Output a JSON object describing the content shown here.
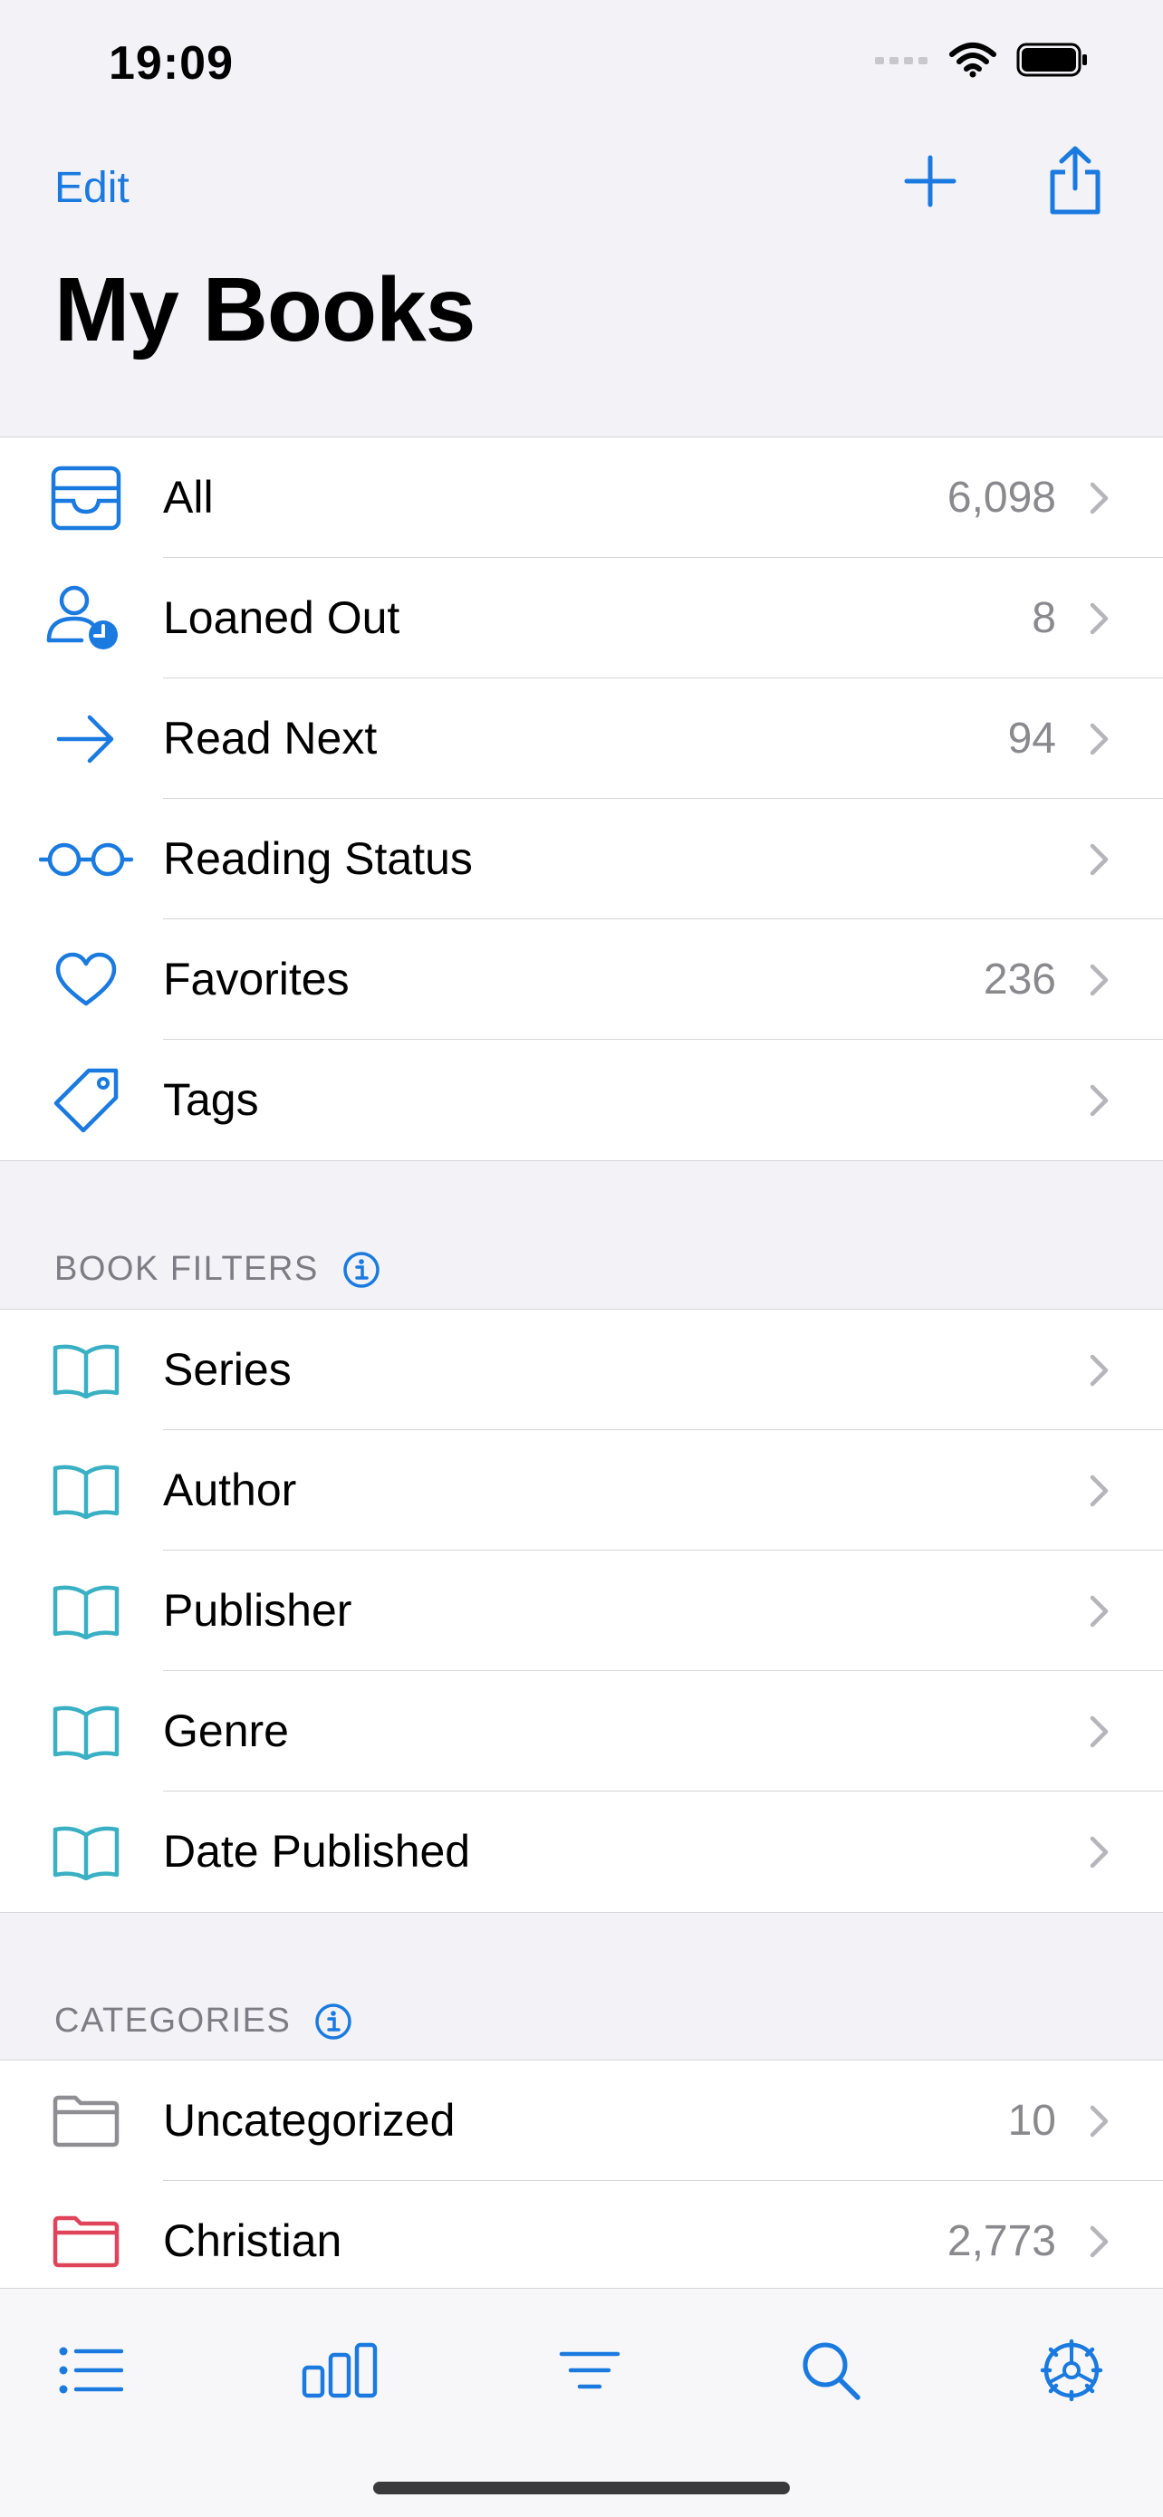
{
  "status": {
    "time": "19:09"
  },
  "nav": {
    "edit_label": "Edit",
    "title": "My Books"
  },
  "library": [
    {
      "icon": "tray-icon",
      "label": "All",
      "count": "6,098"
    },
    {
      "icon": "person-clock-icon",
      "label": "Loaned Out",
      "count": "8"
    },
    {
      "icon": "arrow-right-icon",
      "label": "Read Next",
      "count": "94"
    },
    {
      "icon": "glasses-icon",
      "label": "Reading Status",
      "count": ""
    },
    {
      "icon": "heart-icon",
      "label": "Favorites",
      "count": "236"
    },
    {
      "icon": "tag-icon",
      "label": "Tags",
      "count": ""
    }
  ],
  "book_filters": {
    "header": "BOOK FILTERS",
    "items": [
      {
        "icon": "book-icon",
        "label": "Series"
      },
      {
        "icon": "book-icon",
        "label": "Author"
      },
      {
        "icon": "book-icon",
        "label": "Publisher"
      },
      {
        "icon": "book-icon",
        "label": "Genre"
      },
      {
        "icon": "book-icon",
        "label": "Date Published"
      }
    ]
  },
  "categories": {
    "header": "CATEGORIES",
    "items": [
      {
        "icon": "folder-icon",
        "label": "Uncategorized",
        "count": "10",
        "color": "#8e8e93"
      },
      {
        "icon": "folder-icon",
        "label": "Christian",
        "count": "2,773",
        "color": "#e0445a"
      }
    ]
  },
  "colors": {
    "accent": "#1a7ae0",
    "teal": "#3ab0c4",
    "chevron": "#b5b5ba"
  },
  "tabs": [
    {
      "icon": "list-icon"
    },
    {
      "icon": "bar-chart-icon"
    },
    {
      "icon": "filter-lines-icon"
    },
    {
      "icon": "search-icon"
    },
    {
      "icon": "settings-wheel-icon"
    }
  ]
}
